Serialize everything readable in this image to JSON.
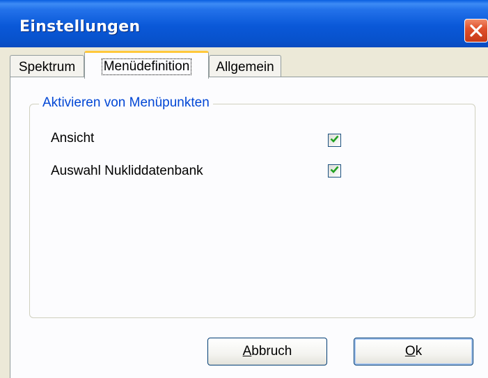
{
  "window": {
    "title": "Einstellungen",
    "close_icon": "close-x-icon"
  },
  "tabs": [
    {
      "label": "Spektrum",
      "active": false
    },
    {
      "label": "Menüdefinition",
      "active": true
    },
    {
      "label": "Allgemein",
      "active": false
    }
  ],
  "group": {
    "legend": "Aktivieren von Menüpunkten",
    "items": [
      {
        "label": "Ansicht",
        "checked": true
      },
      {
        "label": "Auswahl Nukliddatenbank",
        "checked": true
      }
    ]
  },
  "buttons": {
    "cancel": {
      "mnemonic": "A",
      "rest": "bbruch"
    },
    "ok": {
      "mnemonic": "O",
      "rest": "k"
    }
  },
  "colors": {
    "titlebar": "#0a58d8",
    "legend_text": "#0046d5",
    "checkmark": "#21a121",
    "active_tab_accent": "#ffc83c",
    "close_button": "#e0512c"
  }
}
